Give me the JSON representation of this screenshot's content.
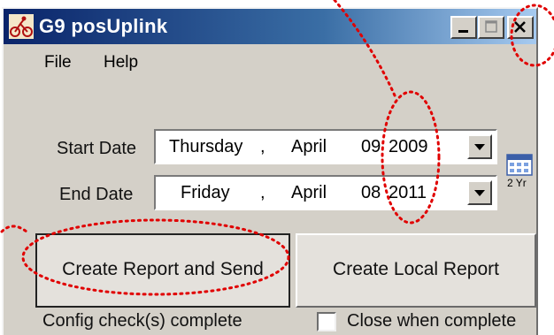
{
  "window": {
    "title": "G9 posUplink",
    "app_icon": "cyclist-icon",
    "controls": [
      "minimize-icon",
      "maximize-icon",
      "close-icon"
    ]
  },
  "menu": {
    "items": [
      {
        "label": "File"
      },
      {
        "label": "Help"
      }
    ]
  },
  "dates": {
    "start": {
      "label": "Start Date",
      "weekday": "Thursday",
      "sep": ",",
      "month": "April",
      "day": "09",
      "year": "2009"
    },
    "end": {
      "label": "End Date",
      "weekday": "Friday",
      "sep": ",",
      "month": "April",
      "day": "08",
      "year": "2011"
    }
  },
  "shortcut": {
    "label": "2 Yr",
    "icon": "calendar-icon"
  },
  "buttons": {
    "send": "Create Report and Send",
    "local": "Create Local Report"
  },
  "status": {
    "text": "Config  check(s) complete",
    "checkbox_label": "Close when complete",
    "checked": false
  },
  "colors": {
    "annotation": "#e00000",
    "title_bar": "#0a246a",
    "window_bg": "#d4d0c8"
  }
}
